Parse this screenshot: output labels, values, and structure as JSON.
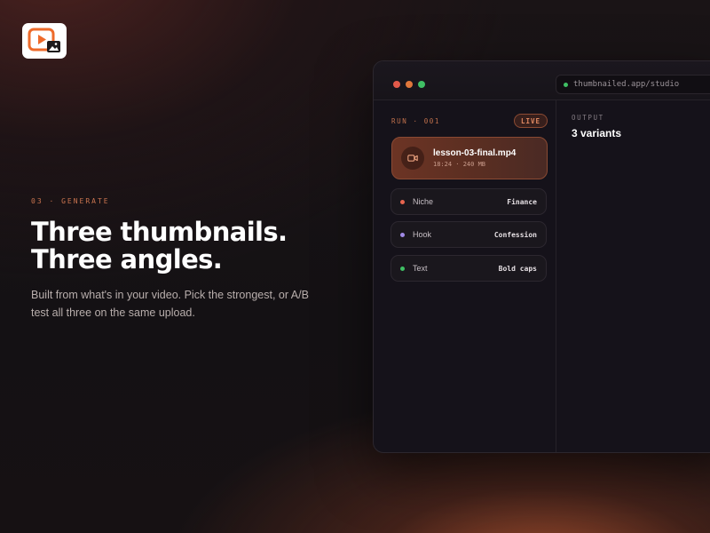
{
  "hero": {
    "eyebrow": "03 · GENERATE",
    "headline": "Three thumbnails. Three angles.",
    "subcopy": "Built from what's in your video. Pick the strongest, or A/B test all three on the same upload."
  },
  "browser": {
    "url": "thumbnailed.app/studio"
  },
  "run": {
    "label": "RUN · 001",
    "status": "LIVE"
  },
  "file": {
    "name": "lesson-03-final.mp4",
    "meta": "18:24 · 240 MB"
  },
  "params": [
    {
      "label": "Niche",
      "value": "Finance",
      "color": "#e8654f"
    },
    {
      "label": "Hook",
      "value": "Confession",
      "color": "#a08ae6"
    },
    {
      "label": "Text",
      "value": "Bold caps",
      "color": "#3fbf64"
    }
  ],
  "output": {
    "label": "OUTPUT",
    "count": "3 variants"
  },
  "colors": {
    "accent": "#e0773b",
    "badge": "#e28a62"
  },
  "icons": {
    "logo": "play-image-logo",
    "file": "video-camera-icon"
  }
}
